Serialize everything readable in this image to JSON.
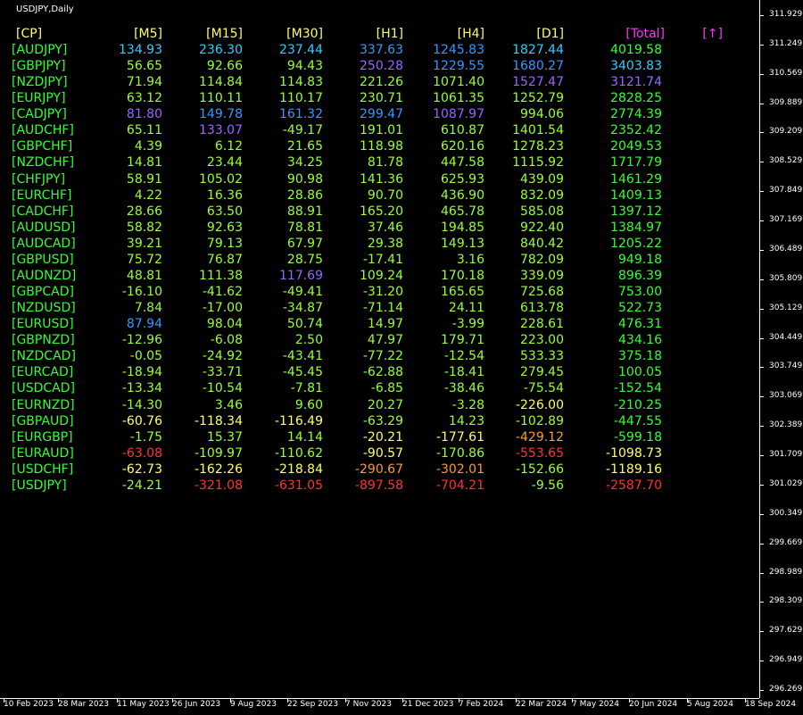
{
  "chart_title": "USDJPY,Daily",
  "price_axis": [
    "311.929",
    "311.249",
    "310.569",
    "309.889",
    "309.209",
    "308.529",
    "307.849",
    "307.169",
    "306.489",
    "305.809",
    "305.129",
    "304.449",
    "303.749",
    "303.069",
    "302.389",
    "301.709",
    "301.029",
    "300.349",
    "299.669",
    "298.989",
    "298.309",
    "297.629",
    "296.949",
    "296.269"
  ],
  "time_axis": [
    "10 Feb 2023",
    "28 Mar 2023",
    "11 May 2023",
    "26 Jun 2023",
    "9 Aug 2023",
    "22 Sep 2023",
    "7 Nov 2023",
    "21 Dec 2023",
    "7 Feb 2024",
    "22 Mar 2024",
    "7 May 2024",
    "20 Jun 2024",
    "5 Aug 2024",
    "18 Sep 2024"
  ],
  "colors": {
    "header": "#ffff66",
    "header_total": "#ff33ff",
    "label": "#33ff33",
    "green": "#33ff33",
    "lime": "#99ff33",
    "cyan": "#33ccff",
    "blue": "#3399ff",
    "purple": "#9966ff",
    "yellow": "#ffff66",
    "orange": "#ff9933",
    "red": "#ff3333"
  },
  "table": {
    "headers": [
      {
        "text": "[CP]",
        "color": "header"
      },
      {
        "text": "[M5]",
        "color": "header"
      },
      {
        "text": "[M15]",
        "color": "header"
      },
      {
        "text": "[M30]",
        "color": "header"
      },
      {
        "text": "[H1]",
        "color": "header"
      },
      {
        "text": "[H4]",
        "color": "header"
      },
      {
        "text": "[D1]",
        "color": "header"
      },
      {
        "text": "[Total]",
        "color": "header_total"
      },
      {
        "text": "[↑]",
        "color": "header_total"
      }
    ],
    "rows": [
      {
        "pair": "[AUDJPY]",
        "cells": [
          [
            "134.93",
            "cyan"
          ],
          [
            "236.30",
            "cyan"
          ],
          [
            "237.44",
            "cyan"
          ],
          [
            "337.63",
            "blue"
          ],
          [
            "1245.83",
            "blue"
          ],
          [
            "1827.44",
            "cyan"
          ],
          [
            "4019.58",
            "green"
          ]
        ]
      },
      {
        "pair": "[GBPJPY]",
        "cells": [
          [
            "56.65",
            "lime"
          ],
          [
            "92.66",
            "lime"
          ],
          [
            "94.43",
            "lime"
          ],
          [
            "250.28",
            "purple"
          ],
          [
            "1229.55",
            "blue"
          ],
          [
            "1680.27",
            "blue"
          ],
          [
            "3403.83",
            "cyan"
          ]
        ]
      },
      {
        "pair": "[NZDJPY]",
        "cells": [
          [
            "71.94",
            "lime"
          ],
          [
            "114.84",
            "lime"
          ],
          [
            "114.83",
            "lime"
          ],
          [
            "221.26",
            "lime"
          ],
          [
            "1071.40",
            "lime"
          ],
          [
            "1527.47",
            "purple"
          ],
          [
            "3121.74",
            "purple"
          ]
        ]
      },
      {
        "pair": "[EURJPY]",
        "cells": [
          [
            "63.12",
            "lime"
          ],
          [
            "110.11",
            "lime"
          ],
          [
            "110.17",
            "lime"
          ],
          [
            "230.71",
            "lime"
          ],
          [
            "1061.35",
            "lime"
          ],
          [
            "1252.79",
            "lime"
          ],
          [
            "2828.25",
            "green"
          ]
        ]
      },
      {
        "pair": "[CADJPY]",
        "cells": [
          [
            "81.80",
            "purple"
          ],
          [
            "149.78",
            "blue"
          ],
          [
            "161.32",
            "blue"
          ],
          [
            "299.47",
            "blue"
          ],
          [
            "1087.97",
            "purple"
          ],
          [
            "994.06",
            "lime"
          ],
          [
            "2774.39",
            "green"
          ]
        ]
      },
      {
        "pair": "[AUDCHF]",
        "cells": [
          [
            "65.11",
            "lime"
          ],
          [
            "133.07",
            "purple"
          ],
          [
            "-49.17",
            "lime"
          ],
          [
            "191.01",
            "lime"
          ],
          [
            "610.87",
            "lime"
          ],
          [
            "1401.54",
            "lime"
          ],
          [
            "2352.42",
            "green"
          ]
        ]
      },
      {
        "pair": "[GBPCHF]",
        "cells": [
          [
            "4.39",
            "lime"
          ],
          [
            "6.12",
            "lime"
          ],
          [
            "21.65",
            "lime"
          ],
          [
            "118.98",
            "lime"
          ],
          [
            "620.16",
            "lime"
          ],
          [
            "1278.23",
            "lime"
          ],
          [
            "2049.53",
            "green"
          ]
        ]
      },
      {
        "pair": "[NZDCHF]",
        "cells": [
          [
            "14.81",
            "lime"
          ],
          [
            "23.44",
            "lime"
          ],
          [
            "34.25",
            "lime"
          ],
          [
            "81.78",
            "lime"
          ],
          [
            "447.58",
            "lime"
          ],
          [
            "1115.92",
            "lime"
          ],
          [
            "1717.79",
            "green"
          ]
        ]
      },
      {
        "pair": "[CHFJPY]",
        "cells": [
          [
            "58.91",
            "lime"
          ],
          [
            "105.02",
            "lime"
          ],
          [
            "90.98",
            "lime"
          ],
          [
            "141.36",
            "lime"
          ],
          [
            "625.93",
            "lime"
          ],
          [
            "439.09",
            "lime"
          ],
          [
            "1461.29",
            "green"
          ]
        ]
      },
      {
        "pair": "[EURCHF]",
        "cells": [
          [
            "4.22",
            "lime"
          ],
          [
            "16.36",
            "lime"
          ],
          [
            "28.86",
            "lime"
          ],
          [
            "90.70",
            "lime"
          ],
          [
            "436.90",
            "lime"
          ],
          [
            "832.09",
            "lime"
          ],
          [
            "1409.13",
            "green"
          ]
        ]
      },
      {
        "pair": "[CADCHF]",
        "cells": [
          [
            "28.66",
            "lime"
          ],
          [
            "63.50",
            "lime"
          ],
          [
            "88.91",
            "lime"
          ],
          [
            "165.20",
            "lime"
          ],
          [
            "465.78",
            "lime"
          ],
          [
            "585.08",
            "lime"
          ],
          [
            "1397.12",
            "green"
          ]
        ]
      },
      {
        "pair": "[AUDUSD]",
        "cells": [
          [
            "58.82",
            "lime"
          ],
          [
            "92.63",
            "lime"
          ],
          [
            "78.81",
            "lime"
          ],
          [
            "37.46",
            "lime"
          ],
          [
            "194.85",
            "lime"
          ],
          [
            "922.40",
            "lime"
          ],
          [
            "1384.97",
            "green"
          ]
        ]
      },
      {
        "pair": "[AUDCAD]",
        "cells": [
          [
            "39.21",
            "lime"
          ],
          [
            "79.13",
            "lime"
          ],
          [
            "67.97",
            "lime"
          ],
          [
            "29.38",
            "lime"
          ],
          [
            "149.13",
            "lime"
          ],
          [
            "840.42",
            "lime"
          ],
          [
            "1205.22",
            "green"
          ]
        ]
      },
      {
        "pair": "[GBPUSD]",
        "cells": [
          [
            "75.72",
            "lime"
          ],
          [
            "76.87",
            "lime"
          ],
          [
            "28.75",
            "lime"
          ],
          [
            "-17.41",
            "lime"
          ],
          [
            "3.16",
            "lime"
          ],
          [
            "782.09",
            "lime"
          ],
          [
            "949.18",
            "green"
          ]
        ]
      },
      {
        "pair": "[AUDNZD]",
        "cells": [
          [
            "48.81",
            "lime"
          ],
          [
            "111.38",
            "lime"
          ],
          [
            "117.69",
            "purple"
          ],
          [
            "109.24",
            "lime"
          ],
          [
            "170.18",
            "lime"
          ],
          [
            "339.09",
            "lime"
          ],
          [
            "896.39",
            "green"
          ]
        ]
      },
      {
        "pair": "[GBPCAD]",
        "cells": [
          [
            "-16.10",
            "lime"
          ],
          [
            "-41.62",
            "lime"
          ],
          [
            "-49.41",
            "lime"
          ],
          [
            "-31.20",
            "lime"
          ],
          [
            "165.65",
            "lime"
          ],
          [
            "725.68",
            "lime"
          ],
          [
            "753.00",
            "green"
          ]
        ]
      },
      {
        "pair": "[NZDUSD]",
        "cells": [
          [
            "7.84",
            "lime"
          ],
          [
            "-17.00",
            "lime"
          ],
          [
            "-34.87",
            "lime"
          ],
          [
            "-71.14",
            "lime"
          ],
          [
            "24.11",
            "lime"
          ],
          [
            "613.78",
            "lime"
          ],
          [
            "522.73",
            "green"
          ]
        ]
      },
      {
        "pair": "[EURUSD]",
        "cells": [
          [
            "87.94",
            "blue"
          ],
          [
            "98.04",
            "lime"
          ],
          [
            "50.74",
            "lime"
          ],
          [
            "14.97",
            "lime"
          ],
          [
            "-3.99",
            "lime"
          ],
          [
            "228.61",
            "lime"
          ],
          [
            "476.31",
            "green"
          ]
        ]
      },
      {
        "pair": "[GBPNZD]",
        "cells": [
          [
            "-12.96",
            "lime"
          ],
          [
            "-6.08",
            "lime"
          ],
          [
            "2.50",
            "lime"
          ],
          [
            "47.97",
            "lime"
          ],
          [
            "179.71",
            "lime"
          ],
          [
            "223.00",
            "lime"
          ],
          [
            "434.16",
            "green"
          ]
        ]
      },
      {
        "pair": "[NZDCAD]",
        "cells": [
          [
            "-0.05",
            "lime"
          ],
          [
            "-24.92",
            "lime"
          ],
          [
            "-43.41",
            "lime"
          ],
          [
            "-77.22",
            "lime"
          ],
          [
            "-12.54",
            "lime"
          ],
          [
            "533.33",
            "lime"
          ],
          [
            "375.18",
            "green"
          ]
        ]
      },
      {
        "pair": "[EURCAD]",
        "cells": [
          [
            "-18.94",
            "lime"
          ],
          [
            "-33.71",
            "lime"
          ],
          [
            "-45.45",
            "lime"
          ],
          [
            "-62.88",
            "lime"
          ],
          [
            "-18.41",
            "lime"
          ],
          [
            "279.45",
            "lime"
          ],
          [
            "100.05",
            "green"
          ]
        ]
      },
      {
        "pair": "[USDCAD]",
        "cells": [
          [
            "-13.34",
            "lime"
          ],
          [
            "-10.54",
            "lime"
          ],
          [
            "-7.81",
            "lime"
          ],
          [
            "-6.85",
            "lime"
          ],
          [
            "-38.46",
            "lime"
          ],
          [
            "-75.54",
            "lime"
          ],
          [
            "-152.54",
            "green"
          ]
        ]
      },
      {
        "pair": "[EURNZD]",
        "cells": [
          [
            "-14.30",
            "lime"
          ],
          [
            "3.46",
            "lime"
          ],
          [
            "9.60",
            "lime"
          ],
          [
            "20.27",
            "lime"
          ],
          [
            "-3.28",
            "lime"
          ],
          [
            "-226.00",
            "yellow"
          ],
          [
            "-210.25",
            "green"
          ]
        ]
      },
      {
        "pair": "[GBPAUD]",
        "cells": [
          [
            "-60.76",
            "yellow"
          ],
          [
            "-118.34",
            "yellow"
          ],
          [
            "-116.49",
            "yellow"
          ],
          [
            "-63.29",
            "lime"
          ],
          [
            "14.23",
            "lime"
          ],
          [
            "-102.89",
            "lime"
          ],
          [
            "-447.55",
            "green"
          ]
        ]
      },
      {
        "pair": "[EURGBP]",
        "cells": [
          [
            "-1.75",
            "lime"
          ],
          [
            "15.37",
            "lime"
          ],
          [
            "14.14",
            "lime"
          ],
          [
            "-20.21",
            "yellow"
          ],
          [
            "-177.61",
            "yellow"
          ],
          [
            "-429.12",
            "orange"
          ],
          [
            "-599.18",
            "green"
          ]
        ]
      },
      {
        "pair": "[EURAUD]",
        "cells": [
          [
            "-63.08",
            "red"
          ],
          [
            "-109.97",
            "lime"
          ],
          [
            "-110.62",
            "lime"
          ],
          [
            "-90.57",
            "yellow"
          ],
          [
            "-170.86",
            "lime"
          ],
          [
            "-553.65",
            "red"
          ],
          [
            "-1098.73",
            "yellow"
          ]
        ]
      },
      {
        "pair": "[USDCHF]",
        "cells": [
          [
            "-62.73",
            "yellow"
          ],
          [
            "-162.26",
            "yellow"
          ],
          [
            "-218.84",
            "yellow"
          ],
          [
            "-290.67",
            "orange"
          ],
          [
            "-302.01",
            "orange"
          ],
          [
            "-152.66",
            "lime"
          ],
          [
            "-1189.16",
            "yellow"
          ]
        ]
      },
      {
        "pair": "[USDJPY]",
        "cells": [
          [
            "-24.21",
            "lime"
          ],
          [
            "-321.08",
            "red"
          ],
          [
            "-631.05",
            "red"
          ],
          [
            "-897.58",
            "red"
          ],
          [
            "-704.21",
            "red"
          ],
          [
            "-9.56",
            "lime"
          ],
          [
            "-2587.70",
            "red"
          ]
        ]
      }
    ]
  }
}
